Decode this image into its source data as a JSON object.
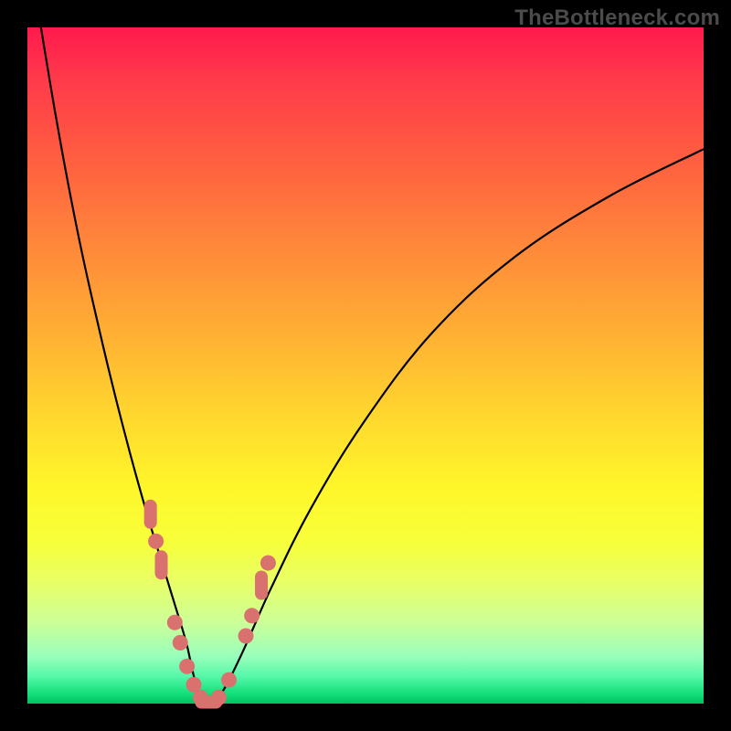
{
  "watermark": "TheBottleneck.com",
  "colors": {
    "frame_bg_top": "#ff1a4d",
    "frame_bg_bottom": "#00c060",
    "curve": "#000000",
    "marker": "#d9716e",
    "page_bg": "#000000",
    "watermark": "#4b4b4b"
  },
  "chart_data": {
    "type": "line",
    "title": "",
    "xlabel": "",
    "ylabel": "",
    "xlim": [
      0,
      100
    ],
    "ylim": [
      0,
      100
    ],
    "grid": false,
    "legend": false,
    "series": [
      {
        "name": "bottleneck-curve",
        "x": [
          2,
          4,
          6,
          8,
          10,
          12,
          14,
          16,
          18,
          20,
          22,
          23.5,
          24.5,
          25.5,
          27,
          29,
          32,
          36,
          42,
          50,
          60,
          72,
          86,
          100
        ],
        "y": [
          100,
          88,
          77,
          67,
          58,
          49.5,
          41.5,
          34,
          27,
          20.5,
          14,
          9,
          4.5,
          1.2,
          0,
          2,
          8,
          17,
          29,
          42,
          55,
          66,
          75,
          82
        ]
      }
    ],
    "markers": [
      {
        "x": 18.2,
        "y": 28.0,
        "shape": "vcapsule"
      },
      {
        "x": 19.0,
        "y": 24.0,
        "shape": "round"
      },
      {
        "x": 19.8,
        "y": 20.5,
        "shape": "vcapsule"
      },
      {
        "x": 21.8,
        "y": 12.0,
        "shape": "round"
      },
      {
        "x": 22.6,
        "y": 9.0,
        "shape": "round"
      },
      {
        "x": 23.6,
        "y": 5.5,
        "shape": "round"
      },
      {
        "x": 24.6,
        "y": 2.8,
        "shape": "round"
      },
      {
        "x": 25.6,
        "y": 0.9,
        "shape": "round"
      },
      {
        "x": 26.8,
        "y": 0.2,
        "shape": "hcapsule"
      },
      {
        "x": 28.3,
        "y": 0.9,
        "shape": "round"
      },
      {
        "x": 29.8,
        "y": 3.5,
        "shape": "round"
      },
      {
        "x": 32.3,
        "y": 10.0,
        "shape": "round"
      },
      {
        "x": 33.2,
        "y": 13.0,
        "shape": "round"
      },
      {
        "x": 34.6,
        "y": 17.5,
        "shape": "vcapsule"
      },
      {
        "x": 35.6,
        "y": 20.8,
        "shape": "round"
      }
    ],
    "notch_x": 27.0
  }
}
